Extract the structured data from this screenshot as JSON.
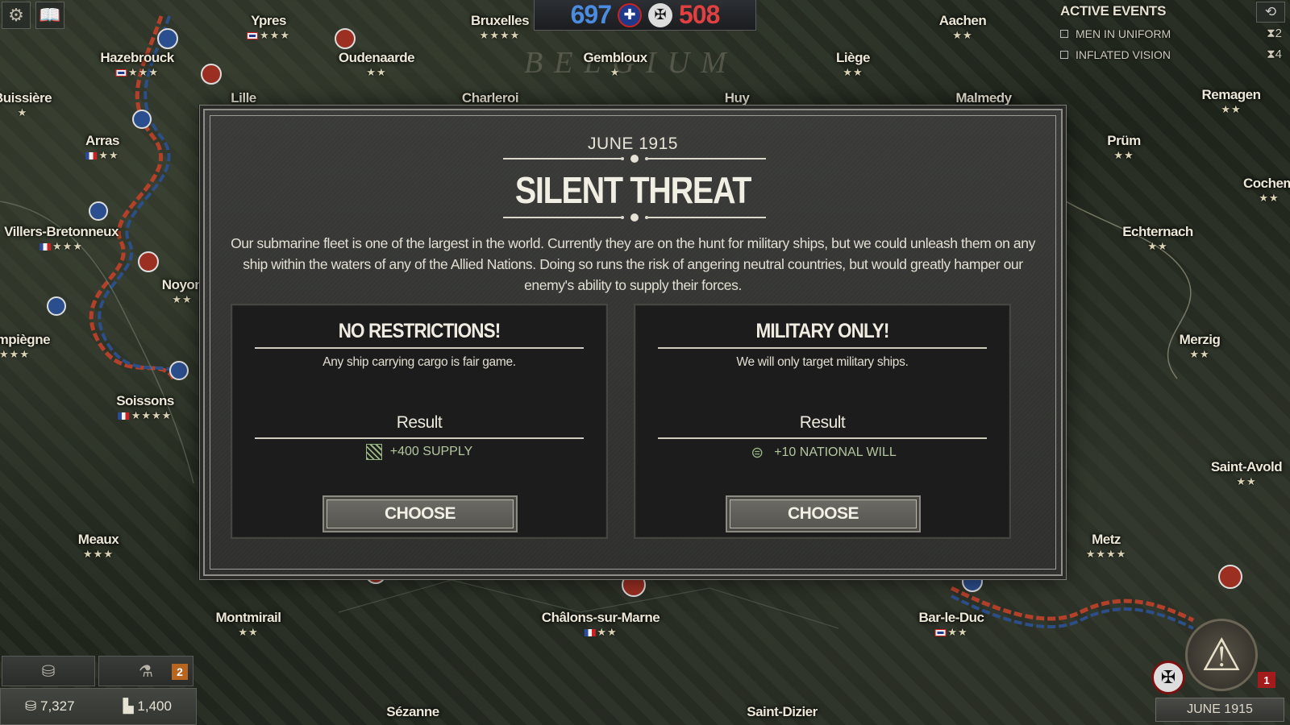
{
  "top_left": {
    "settings_icon": "gear-icon",
    "codex_icon": "book-icon"
  },
  "score": {
    "allied": "697",
    "central": "508"
  },
  "active_events": {
    "header": "ACTIVE EVENTS",
    "items": [
      {
        "label": "MEN IN UNIFORM",
        "turns": "2"
      },
      {
        "label": "INFLATED VISION",
        "turns": "4"
      }
    ]
  },
  "map_labels": {
    "region": "BELGIUM",
    "cities": [
      {
        "name": "Ypres",
        "stars": "★★★"
      },
      {
        "name": "Bruxelles",
        "stars": "★★★★"
      },
      {
        "name": "Aachen",
        "stars": "★★"
      },
      {
        "name": "Hazebrouck",
        "stars": "★★★"
      },
      {
        "name": "Oudenaarde",
        "stars": "★★"
      },
      {
        "name": "Gembloux",
        "stars": "★"
      },
      {
        "name": "Liège",
        "stars": "★★"
      },
      {
        "name": "Buissière",
        "stars": "★"
      },
      {
        "name": "Lille",
        "stars": ""
      },
      {
        "name": "Charleroi",
        "stars": ""
      },
      {
        "name": "Huy",
        "stars": ""
      },
      {
        "name": "Malmedy",
        "stars": ""
      },
      {
        "name": "Remagen",
        "stars": "★★"
      },
      {
        "name": "Arras",
        "stars": "★★"
      },
      {
        "name": "Prüm",
        "stars": "★★"
      },
      {
        "name": "Cochem",
        "stars": "★★"
      },
      {
        "name": "Villers-Bretonneux",
        "stars": "★★★"
      },
      {
        "name": "Echternach",
        "stars": "★★"
      },
      {
        "name": "Noyon",
        "stars": "★★"
      },
      {
        "name": "Compiègne",
        "stars": "★★★"
      },
      {
        "name": "Merzig",
        "stars": "★★"
      },
      {
        "name": "Soissons",
        "stars": "★★★★"
      },
      {
        "name": "Saint-Avold",
        "stars": "★★"
      },
      {
        "name": "Meaux",
        "stars": "★★★"
      },
      {
        "name": "Metz",
        "stars": "★★★★"
      },
      {
        "name": "Montmirail",
        "stars": "★★"
      },
      {
        "name": "Châlons-sur-Marne",
        "stars": "★★"
      },
      {
        "name": "Bar-le-Duc",
        "stars": "★★"
      },
      {
        "name": "Sézanne",
        "stars": ""
      },
      {
        "name": "Saint-Dizier",
        "stars": ""
      }
    ]
  },
  "event": {
    "date": "JUNE 1915",
    "title": "SILENT THREAT",
    "description": "Our submarine fleet is one of the largest in the world. Currently they are on the hunt for military ships, but we could unleash them on any ship within the waters of any of the Allied Nations. Doing so runs the risk of angering neutral countries, but would greatly hamper our enemy's ability to supply their forces.",
    "choices": [
      {
        "title": "NO RESTRICTIONS!",
        "description": "Any ship carrying cargo is fair game.",
        "result_label": "Result",
        "effect": "+400 SUPPLY",
        "effect_icon": "supply-icon",
        "button": "CHOOSE"
      },
      {
        "title": "MILITARY ONLY!",
        "description": "We will only target military ships.",
        "result_label": "Result",
        "effect": "+10 NATIONAL WILL",
        "effect_icon": "national-will-icon",
        "button": "CHOOSE"
      }
    ]
  },
  "resources": {
    "research_badge": "2",
    "money": "7,327",
    "industry": "1,400"
  },
  "bottom_right": {
    "alert_count": "1",
    "date": "JUNE 1915"
  },
  "colors": {
    "allied_score": "#4b8be0",
    "central_score": "#e04040",
    "effect_text": "#b3c6a0",
    "modal_bg": "#363734"
  }
}
